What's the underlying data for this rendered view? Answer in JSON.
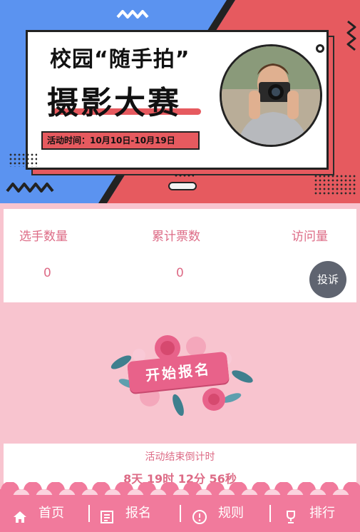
{
  "banner": {
    "title_line1": "校园“随手拍”",
    "title_line2": "摄影大赛",
    "date_text": "活动时间：10月10日-10月19日",
    "accent_color": "#e65a5f",
    "blue_color": "#5b93f0"
  },
  "stats": {
    "items": [
      {
        "label": "选手数量",
        "value": "0"
      },
      {
        "label": "累计票数",
        "value": "0"
      },
      {
        "label": "访问量",
        "value": ""
      }
    ]
  },
  "complain_button": {
    "label": "投诉"
  },
  "signup": {
    "label": "开始报名"
  },
  "countdown": {
    "title": "活动结束倒计时",
    "time": "8天 19时 12分 56秒"
  },
  "nav": {
    "items": [
      {
        "label": "首页",
        "icon": "home-icon"
      },
      {
        "label": "报名",
        "icon": "signup-icon"
      },
      {
        "label": "规则",
        "icon": "info-icon"
      },
      {
        "label": "排行",
        "icon": "trophy-icon"
      }
    ],
    "color": "#f17a9c"
  }
}
